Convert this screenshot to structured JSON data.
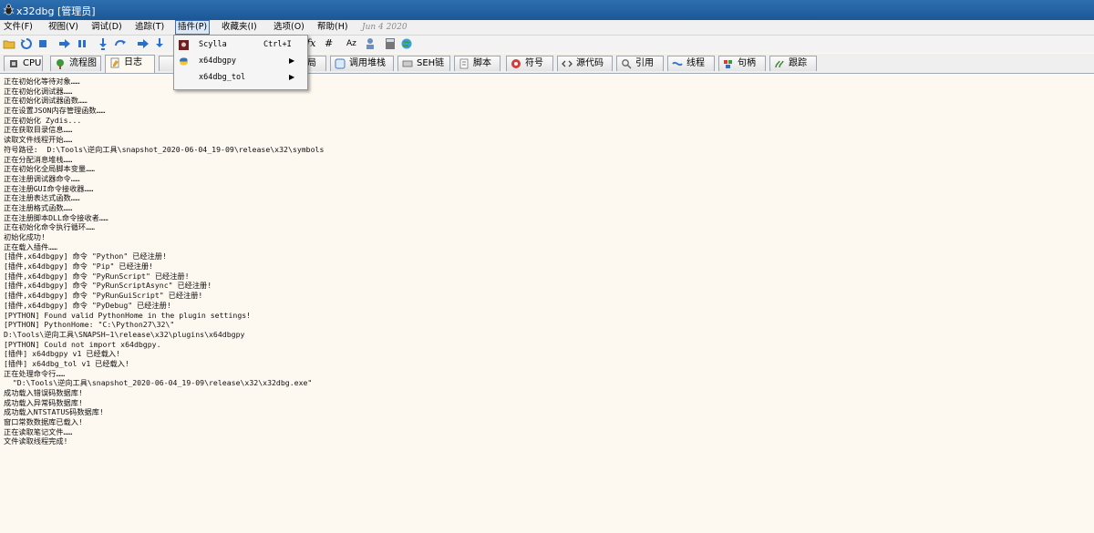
{
  "window": {
    "title": "x32dbg [管理员]"
  },
  "menu": {
    "items": [
      "文件(F)",
      "视图(V)",
      "调试(D)",
      "追踪(T)",
      "插件(P)",
      "收藏夹(I)",
      "选项(O)",
      "帮助(H)"
    ],
    "active_index": 4,
    "date": "Jun 4 2020"
  },
  "toolbar": {
    "fx_label": "fx",
    "hash_label": "#",
    "az_label": "Az"
  },
  "tabs": [
    {
      "label": "CPU",
      "icon": "cpu-icon"
    },
    {
      "label": "流程图",
      "icon": "graph-icon"
    },
    {
      "label": "日志",
      "icon": "log-icon",
      "active": true
    },
    {
      "label": "局",
      "icon": "memory-icon"
    },
    {
      "label": "调用堆栈",
      "icon": "call-stack-icon"
    },
    {
      "label": "SEH链",
      "icon": "seh-icon"
    },
    {
      "label": "脚本",
      "icon": "script-icon"
    },
    {
      "label": "符号",
      "icon": "symbol-icon"
    },
    {
      "label": "源代码",
      "icon": "source-icon"
    },
    {
      "label": "引用",
      "icon": "references-icon"
    },
    {
      "label": "线程",
      "icon": "threads-icon"
    },
    {
      "label": "句柄",
      "icon": "handles-icon"
    },
    {
      "label": "跟踪",
      "icon": "trace-icon"
    }
  ],
  "plugin_menu": [
    {
      "label": "Scylla",
      "shortcut": "Ctrl+I",
      "submenu": false,
      "icon": "scylla-icon"
    },
    {
      "label": "x64dbgpy",
      "shortcut": "",
      "submenu": true,
      "icon": "python-icon"
    },
    {
      "label": "x64dbg_tol",
      "shortcut": "",
      "submenu": true,
      "icon": ""
    }
  ],
  "submenu_arrow": "▶",
  "log_lines": [
    "正在初始化等待对象……",
    "正在初始化调试器……",
    "正在初始化调试器函数……",
    "正在设置JSON内存管理函数……",
    "正在初始化 Zydis...",
    "正在获取目录信息……",
    "读取文件线程开始……",
    "符号路径:  D:\\Tools\\逆向工具\\snapshot_2020-06-04_19-09\\release\\x32\\symbols",
    "正在分配消息堆栈……",
    "正在初始化全局脚本变量……",
    "正在注册调试器命令……",
    "正在注册GUI命令接收器……",
    "正在注册表达式函数……",
    "正在注册格式函数……",
    "正在注册脚本DLL命令接收者……",
    "正在初始化命令执行循环……",
    "初始化成功!",
    "正在载入插件……",
    "[插件,x64dbgpy] 命令 \"Python\" 已经注册!",
    "[插件,x64dbgpy] 命令 \"Pip\" 已经注册!",
    "[插件,x64dbgpy] 命令 \"PyRunScript\" 已经注册!",
    "[插件,x64dbgpy] 命令 \"PyRunScriptAsync\" 已经注册!",
    "[插件,x64dbgpy] 命令 \"PyRunGuiScript\" 已经注册!",
    "[插件,x64dbgpy] 命令 \"PyDebug\" 已经注册!",
    "[PYTHON] Found valid PythonHome in the plugin settings!",
    "[PYTHON] PythonHome: \"C:\\Python27\\32\\\"",
    "D:\\Tools\\逆向工具\\SNAPSH~1\\release\\x32\\plugins\\x64dbgpy",
    "[PYTHON] Could not import x64dbgpy.",
    "[插件] x64dbgpy v1 已经载入!",
    "[插件] x64dbg_tol v1 已经载入!",
    "正在处理命令行……",
    "  \"D:\\Tools\\逆向工具\\snapshot_2020-06-04_19-09\\release\\x32\\x32dbg.exe\"",
    "成功载入错误码数据库!",
    "成功载入异常码数据库!",
    "成功载入NTSTATUS码数据库!",
    "窗口常数数据库已载入!",
    "正在读取笔记文件……",
    "文件读取线程完成!"
  ]
}
